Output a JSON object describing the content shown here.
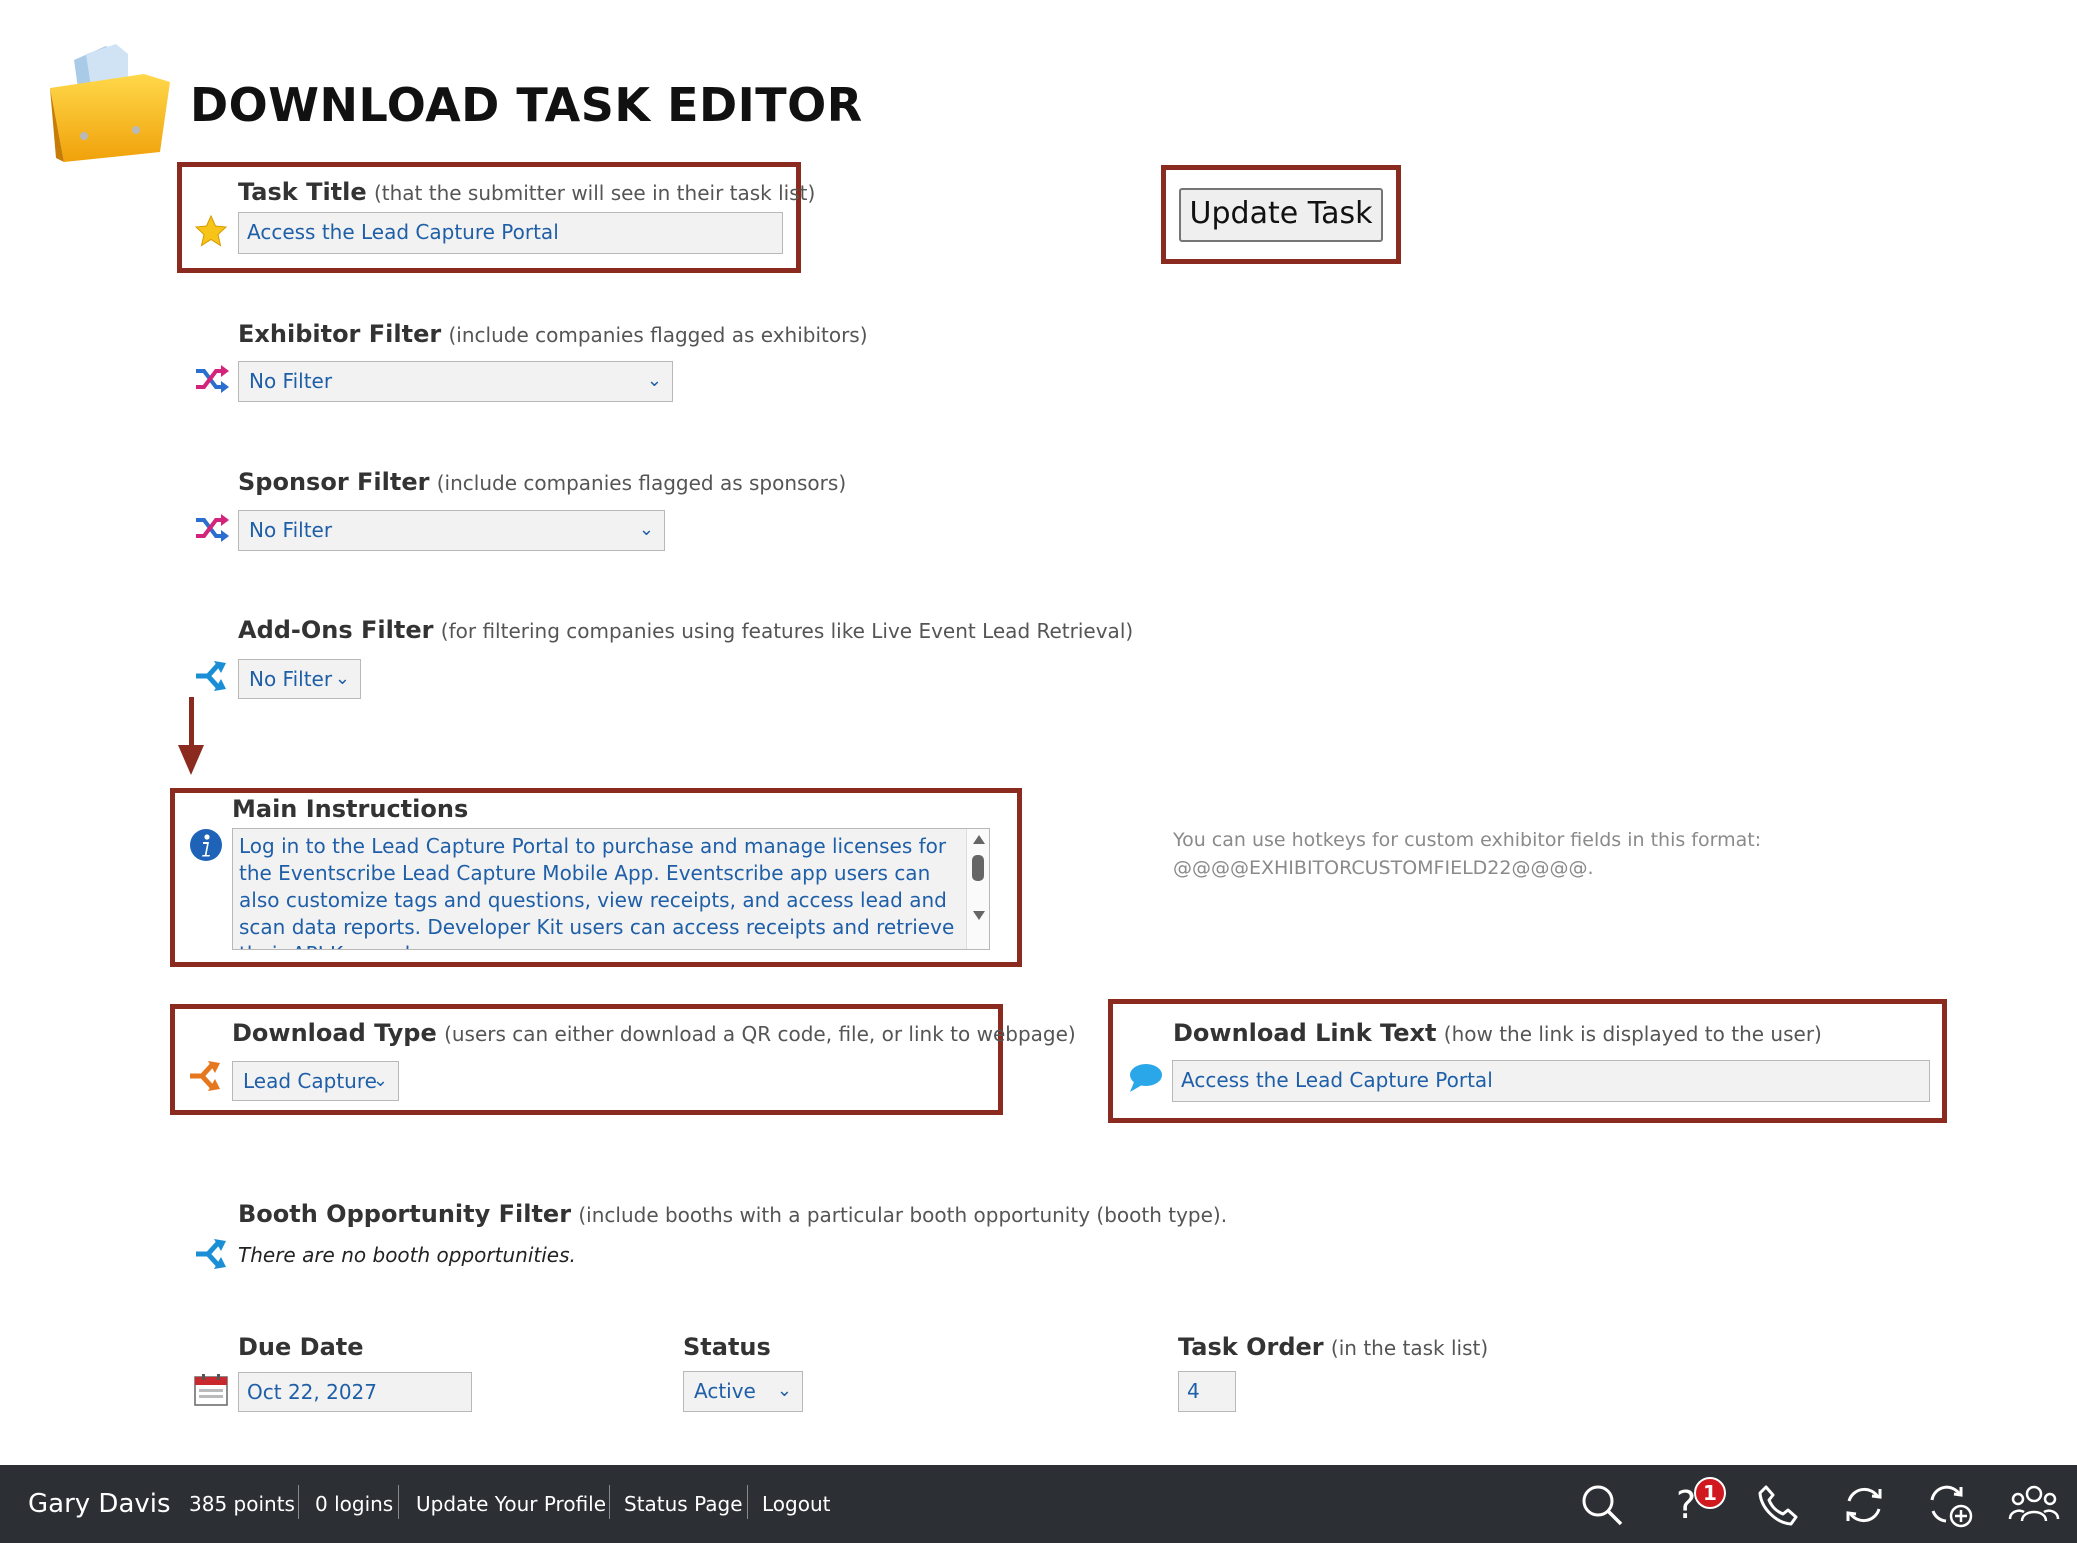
{
  "header": {
    "title": "DOWNLOAD TASK EDITOR",
    "folder_icon": "folder-icon"
  },
  "task_title": {
    "label": "Task Title",
    "hint": "(that the submitter will see in their task list)",
    "value": "Access the Lead Capture Portal",
    "icon": "star-icon"
  },
  "update_button": {
    "label": "Update Task"
  },
  "exhibitor_filter": {
    "label": "Exhibitor Filter",
    "hint": "(include companies flagged as exhibitors)",
    "selected": "No Filter",
    "icon": "shuffle-icon"
  },
  "sponsor_filter": {
    "label": "Sponsor Filter",
    "hint": "(include companies flagged as sponsors)",
    "selected": "No Filter",
    "icon": "shuffle-icon"
  },
  "addons_filter": {
    "label": "Add-Ons Filter",
    "hint": "(for filtering companies using features like Live Event Lead Retrieval)",
    "selected": "No Filter",
    "icon": "merge-arrows-icon"
  },
  "main_instructions": {
    "label": "Main Instructions",
    "value": "Log in to the Lead Capture Portal to purchase and manage licenses for the Eventscribe Lead Capture Mobile App. Eventscribe app users can also customize tags and questions, view receipts, and access lead and scan data reports. Developer Kit users can access receipts and retrieve their API Key and",
    "icon": "info-icon"
  },
  "hotkey_note": {
    "line1": "You can use hotkeys for custom exhibitor fields in this format:",
    "line2": "@@@@EXHIBITORCUSTOMFIELD22@@@@."
  },
  "download_type": {
    "label": "Download Type",
    "hint": "(users can either download a QR code, file, or link to webpage)",
    "selected": "Lead Capture",
    "icon": "merge-arrows-icon"
  },
  "download_link_text": {
    "label": "Download Link Text",
    "hint": "(how the link is displayed to the user)",
    "value": "Access the Lead Capture Portal",
    "icon": "speech-bubble-icon"
  },
  "booth_filter": {
    "label": "Booth Opportunity Filter",
    "hint": "(include booths with a particular booth opportunity (booth type).",
    "empty_text": "There are no booth opportunities.",
    "icon": "merge-arrows-icon"
  },
  "due_date": {
    "label": "Due Date",
    "value": "Oct 22, 2027",
    "icon": "calendar-icon"
  },
  "status": {
    "label": "Status",
    "selected": "Active"
  },
  "task_order": {
    "label": "Task Order",
    "hint": "(in the task list)",
    "value": "4"
  },
  "footer": {
    "user_name": "Gary Davis",
    "points": "385 points",
    "logins": "0 logins",
    "update_profile": "Update Your Profile",
    "status_page": "Status Page",
    "logout": "Logout",
    "help_badge": "1",
    "icons": [
      "search-icon",
      "help-icon",
      "phone-icon",
      "refresh-icon",
      "sync-add-icon",
      "users-icon"
    ]
  },
  "colors": {
    "highlight": "#8b2a1e",
    "link_blue": "#1f5fa8",
    "footer_bg": "#2c2f33",
    "badge_red": "#d0181f"
  }
}
